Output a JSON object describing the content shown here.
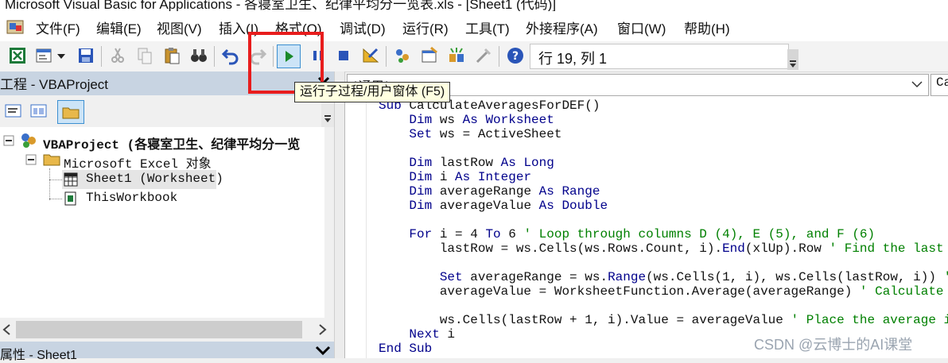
{
  "window": {
    "title": "Microsoft Visual Basic for Applications - 各寝室卫生、纪律平均分一览表.xls - [Sheet1 (代码)]"
  },
  "menu": {
    "items": [
      {
        "label": "文件(F)"
      },
      {
        "label": "编辑(E)"
      },
      {
        "label": "视图(V)"
      },
      {
        "label": "插入(I)"
      },
      {
        "label": "格式(O)"
      },
      {
        "label": "调试(D)"
      },
      {
        "label": "运行(R)"
      },
      {
        "label": "工具(T)"
      },
      {
        "label": "外接程序(A)"
      },
      {
        "label": "窗口(W)"
      },
      {
        "label": "帮助(H)"
      }
    ]
  },
  "toolbar": {
    "position_text": "行 19, 列 1",
    "tooltip": "运行子过程/用户窗体 (F5)",
    "icons": [
      "excel-icon",
      "insert-userform-icon",
      "save-icon",
      "cut-icon",
      "copy-icon",
      "paste-icon",
      "find-icon",
      "undo-icon",
      "redo-icon",
      "run-icon",
      "break-icon",
      "reset-icon",
      "design-mode-icon",
      "project-explorer-icon",
      "properties-icon",
      "object-browser-icon",
      "toolbox-icon",
      "help-icon"
    ],
    "highlight_color": "#e81d1d"
  },
  "project_panel": {
    "title": "工程 - VBAProject",
    "tree": {
      "root": "VBAProject (各寝室卫生、纪律平均分一览",
      "folder": "Microsoft Excel 对象",
      "items": [
        "Sheet1 (Worksheet)",
        "ThisWorkbook"
      ]
    }
  },
  "properties_panel": {
    "title": "属性 - Sheet1"
  },
  "code_window": {
    "object_dropdown": "(通用)",
    "procedure_dropdown": "Ca",
    "lines": [
      {
        "code": "Sub CalculateAveragesForDEF()",
        "comment": ""
      },
      {
        "code": "    Dim ws As Worksheet",
        "comment": ""
      },
      {
        "code": "    Set ws = ActiveSheet",
        "comment": ""
      },
      {
        "code": "",
        "comment": ""
      },
      {
        "code": "    Dim lastRow As Long",
        "comment": ""
      },
      {
        "code": "    Dim i As Integer",
        "comment": ""
      },
      {
        "code": "    Dim averageRange As Range",
        "comment": ""
      },
      {
        "code": "    Dim averageValue As Double",
        "comment": ""
      },
      {
        "code": "",
        "comment": ""
      },
      {
        "code": "    For i = 4 To 6 ",
        "comment": "' Loop through columns D (4), E (5), and F (6)"
      },
      {
        "code": "        lastRow = ws.Cells(ws.Rows.Count, i).End(xlUp).Row ",
        "comment": "' Find the last row w"
      },
      {
        "code": "",
        "comment": ""
      },
      {
        "code": "        Set averageRange = ws.Range(ws.Cells(1, i), ws.Cells(lastRow, i)) ",
        "comment": "' Set"
      },
      {
        "code": "        averageValue = WorksheetFunction.Average(averageRange) ",
        "comment": "' Calculate the a"
      },
      {
        "code": "",
        "comment": ""
      },
      {
        "code": "        ws.Cells(lastRow + 1, i).Value = averageValue ",
        "comment": "' Place the average in the"
      },
      {
        "code": "    Next i",
        "comment": ""
      },
      {
        "code": "End Sub",
        "comment": ""
      }
    ]
  },
  "watermark": "CSDN @云博士的AI课堂"
}
